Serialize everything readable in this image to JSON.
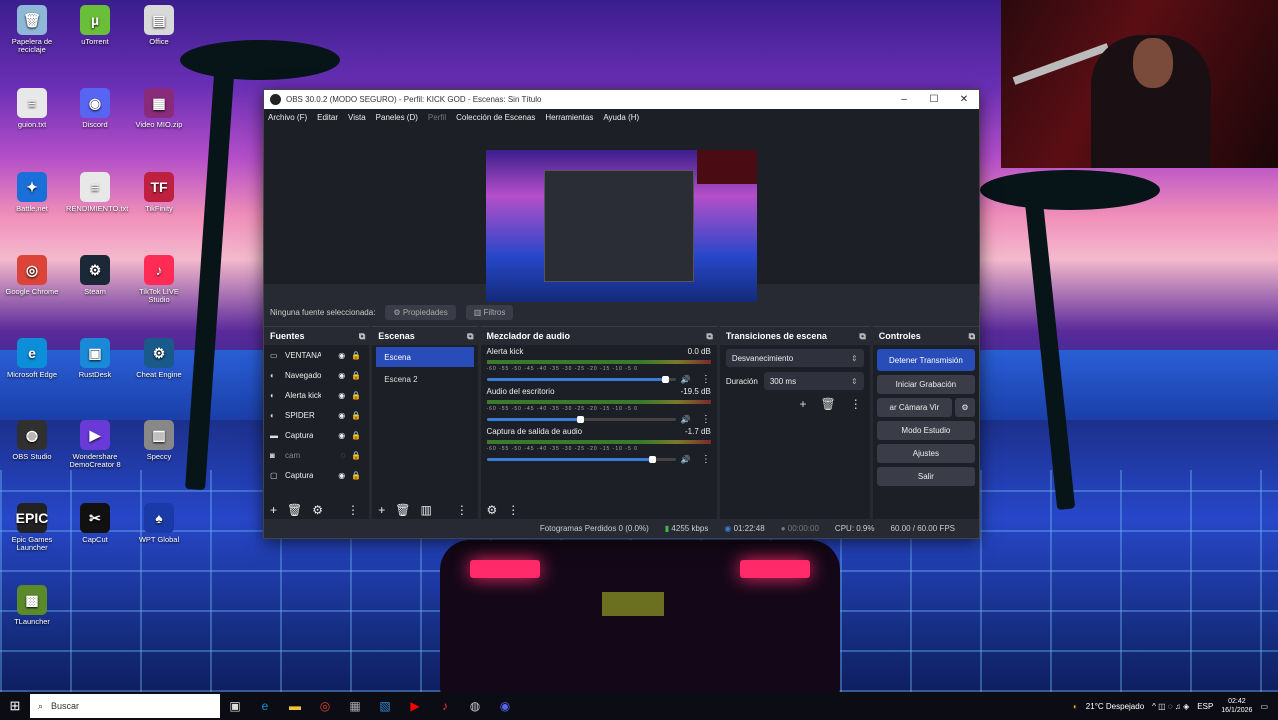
{
  "desktop": {
    "icons": [
      {
        "label": "Papelera de reciclaje",
        "icon": "recycle-bin-icon",
        "color": "#8fb8d8",
        "glyph": "🗑"
      },
      {
        "label": "uTorrent",
        "icon": "utorrent-icon",
        "color": "#6abf3a",
        "glyph": "µ"
      },
      {
        "label": "Office",
        "icon": "office-icon",
        "color": "#d9d9d9",
        "glyph": "▤"
      },
      {
        "label": "guion.txt",
        "icon": "text-file-icon",
        "color": "#e8e8e8",
        "glyph": "≡"
      },
      {
        "label": "Discord",
        "icon": "discord-icon",
        "color": "#5865f2",
        "glyph": "◉"
      },
      {
        "label": "Video MIO.zip",
        "icon": "winrar-icon",
        "color": "#8a2a7a",
        "glyph": "▦"
      },
      {
        "label": "Battle.net",
        "icon": "battlenet-icon",
        "color": "#1a6fd8",
        "glyph": "✦"
      },
      {
        "label": "RENDIMIENTO.txt",
        "icon": "text-file-icon",
        "color": "#e8e8e8",
        "glyph": "≡"
      },
      {
        "label": "TikFinity",
        "icon": "tikfinity-icon",
        "color": "#c02040",
        "glyph": "TF"
      },
      {
        "label": "Google Chrome",
        "icon": "chrome-icon",
        "color": "#db4437",
        "glyph": "◎"
      },
      {
        "label": "Steam",
        "icon": "steam-icon",
        "color": "#1b2838",
        "glyph": "⚙"
      },
      {
        "label": "TikTok LIVE Studio",
        "icon": "tiktok-icon",
        "color": "#fe2c55",
        "glyph": "♪"
      },
      {
        "label": "Microsoft Edge",
        "icon": "edge-icon",
        "color": "#0c8ed9",
        "glyph": "e"
      },
      {
        "label": "RustDesk",
        "icon": "rustdesk-icon",
        "color": "#1a8ad8",
        "glyph": "▣"
      },
      {
        "label": "Cheat Engine",
        "icon": "cheat-engine-icon",
        "color": "#1a5a8a",
        "glyph": "⚙"
      },
      {
        "label": "OBS Studio",
        "icon": "obs-icon",
        "color": "#303030",
        "glyph": "◍"
      },
      {
        "label": "Wondershare DemoCreator 8",
        "icon": "democreator-icon",
        "color": "#6a3ad8",
        "glyph": "▶"
      },
      {
        "label": "Speccy",
        "icon": "speccy-icon",
        "color": "#888888",
        "glyph": "▥"
      },
      {
        "label": "Epic Games Launcher",
        "icon": "epic-games-icon",
        "color": "#222222",
        "glyph": "EPIC"
      },
      {
        "label": "CapCut",
        "icon": "capcut-icon",
        "color": "#111111",
        "glyph": "✂"
      },
      {
        "label": "WPT Global",
        "icon": "wpt-global-icon",
        "color": "#1a3aa8",
        "glyph": "♠"
      },
      {
        "label": "TLauncher",
        "icon": "tlauncher-icon",
        "color": "#5a8a2a",
        "glyph": "▩"
      }
    ]
  },
  "obs": {
    "title": "OBS 30.0.2 (MODO SEGURO) - Perfil: KICK GOD - Escenas: Sin Título",
    "menu": [
      "Archivo (F)",
      "Editar",
      "Vista",
      "Paneles (D)",
      "Perfil",
      "Colección de Escenas",
      "Herramientas",
      "Ayuda (H)"
    ],
    "no_source": "Ninguna fuente seleccionada",
    "properties": "Propiedades",
    "filters": "Filtros",
    "sources": {
      "title": "Fuentes",
      "items": [
        {
          "name": "VENTANA",
          "icon": "window-icon"
        },
        {
          "name": "Navegador",
          "icon": "browser-icon"
        },
        {
          "name": "Alerta kick",
          "icon": "browser-icon"
        },
        {
          "name": "SPIDER",
          "icon": "browser-icon"
        },
        {
          "name": "Captura",
          "icon": "monitor-icon"
        },
        {
          "name": "cam",
          "icon": "camera-icon",
          "hidden": true
        },
        {
          "name": "Captura",
          "icon": "display-icon"
        }
      ]
    },
    "scenes": {
      "title": "Escenas",
      "items": [
        "Escena",
        "Escena 2"
      ]
    },
    "mixer": {
      "title": "Mezclador de audio",
      "channels": [
        {
          "name": "Alerta kick",
          "db": "0.0 dB",
          "vol": 0.95
        },
        {
          "name": "Audio del escritorio",
          "db": "-19.5 dB",
          "vol": 0.5
        },
        {
          "name": "Captura de salida de audio",
          "db": "-1.7 dB",
          "vol": 0.88
        }
      ],
      "ticks": "-60 -55 -50 -45 -40 -35 -30 -25 -20 -15 -10 -5 0"
    },
    "transitions": {
      "title": "Transiciones de escena",
      "type": "Desvanecimiento",
      "duration_label": "Duración",
      "duration": "300 ms"
    },
    "controls": {
      "title": "Controles",
      "stop_stream": "Detener Transmisión",
      "start_rec": "Iniciar Grabación",
      "virtual_cam": "ar Cámara Vir",
      "studio": "Modo Estudio",
      "settings": "Ajustes",
      "exit": "Salir"
    },
    "status": {
      "dropped": "Fotogramas Perdidos 0 (0.0%)",
      "bitrate": "4255 kbps",
      "stream_time": "01:22:48",
      "rec_time": "00:00:00",
      "cpu": "CPU: 0.9%",
      "fps": "60.00 / 60.00 FPS"
    }
  },
  "taskbar": {
    "search": "Buscar",
    "weather": "21°C Despejado",
    "lang": "ESP",
    "time": "02:42",
    "date": "16/1/2026"
  }
}
